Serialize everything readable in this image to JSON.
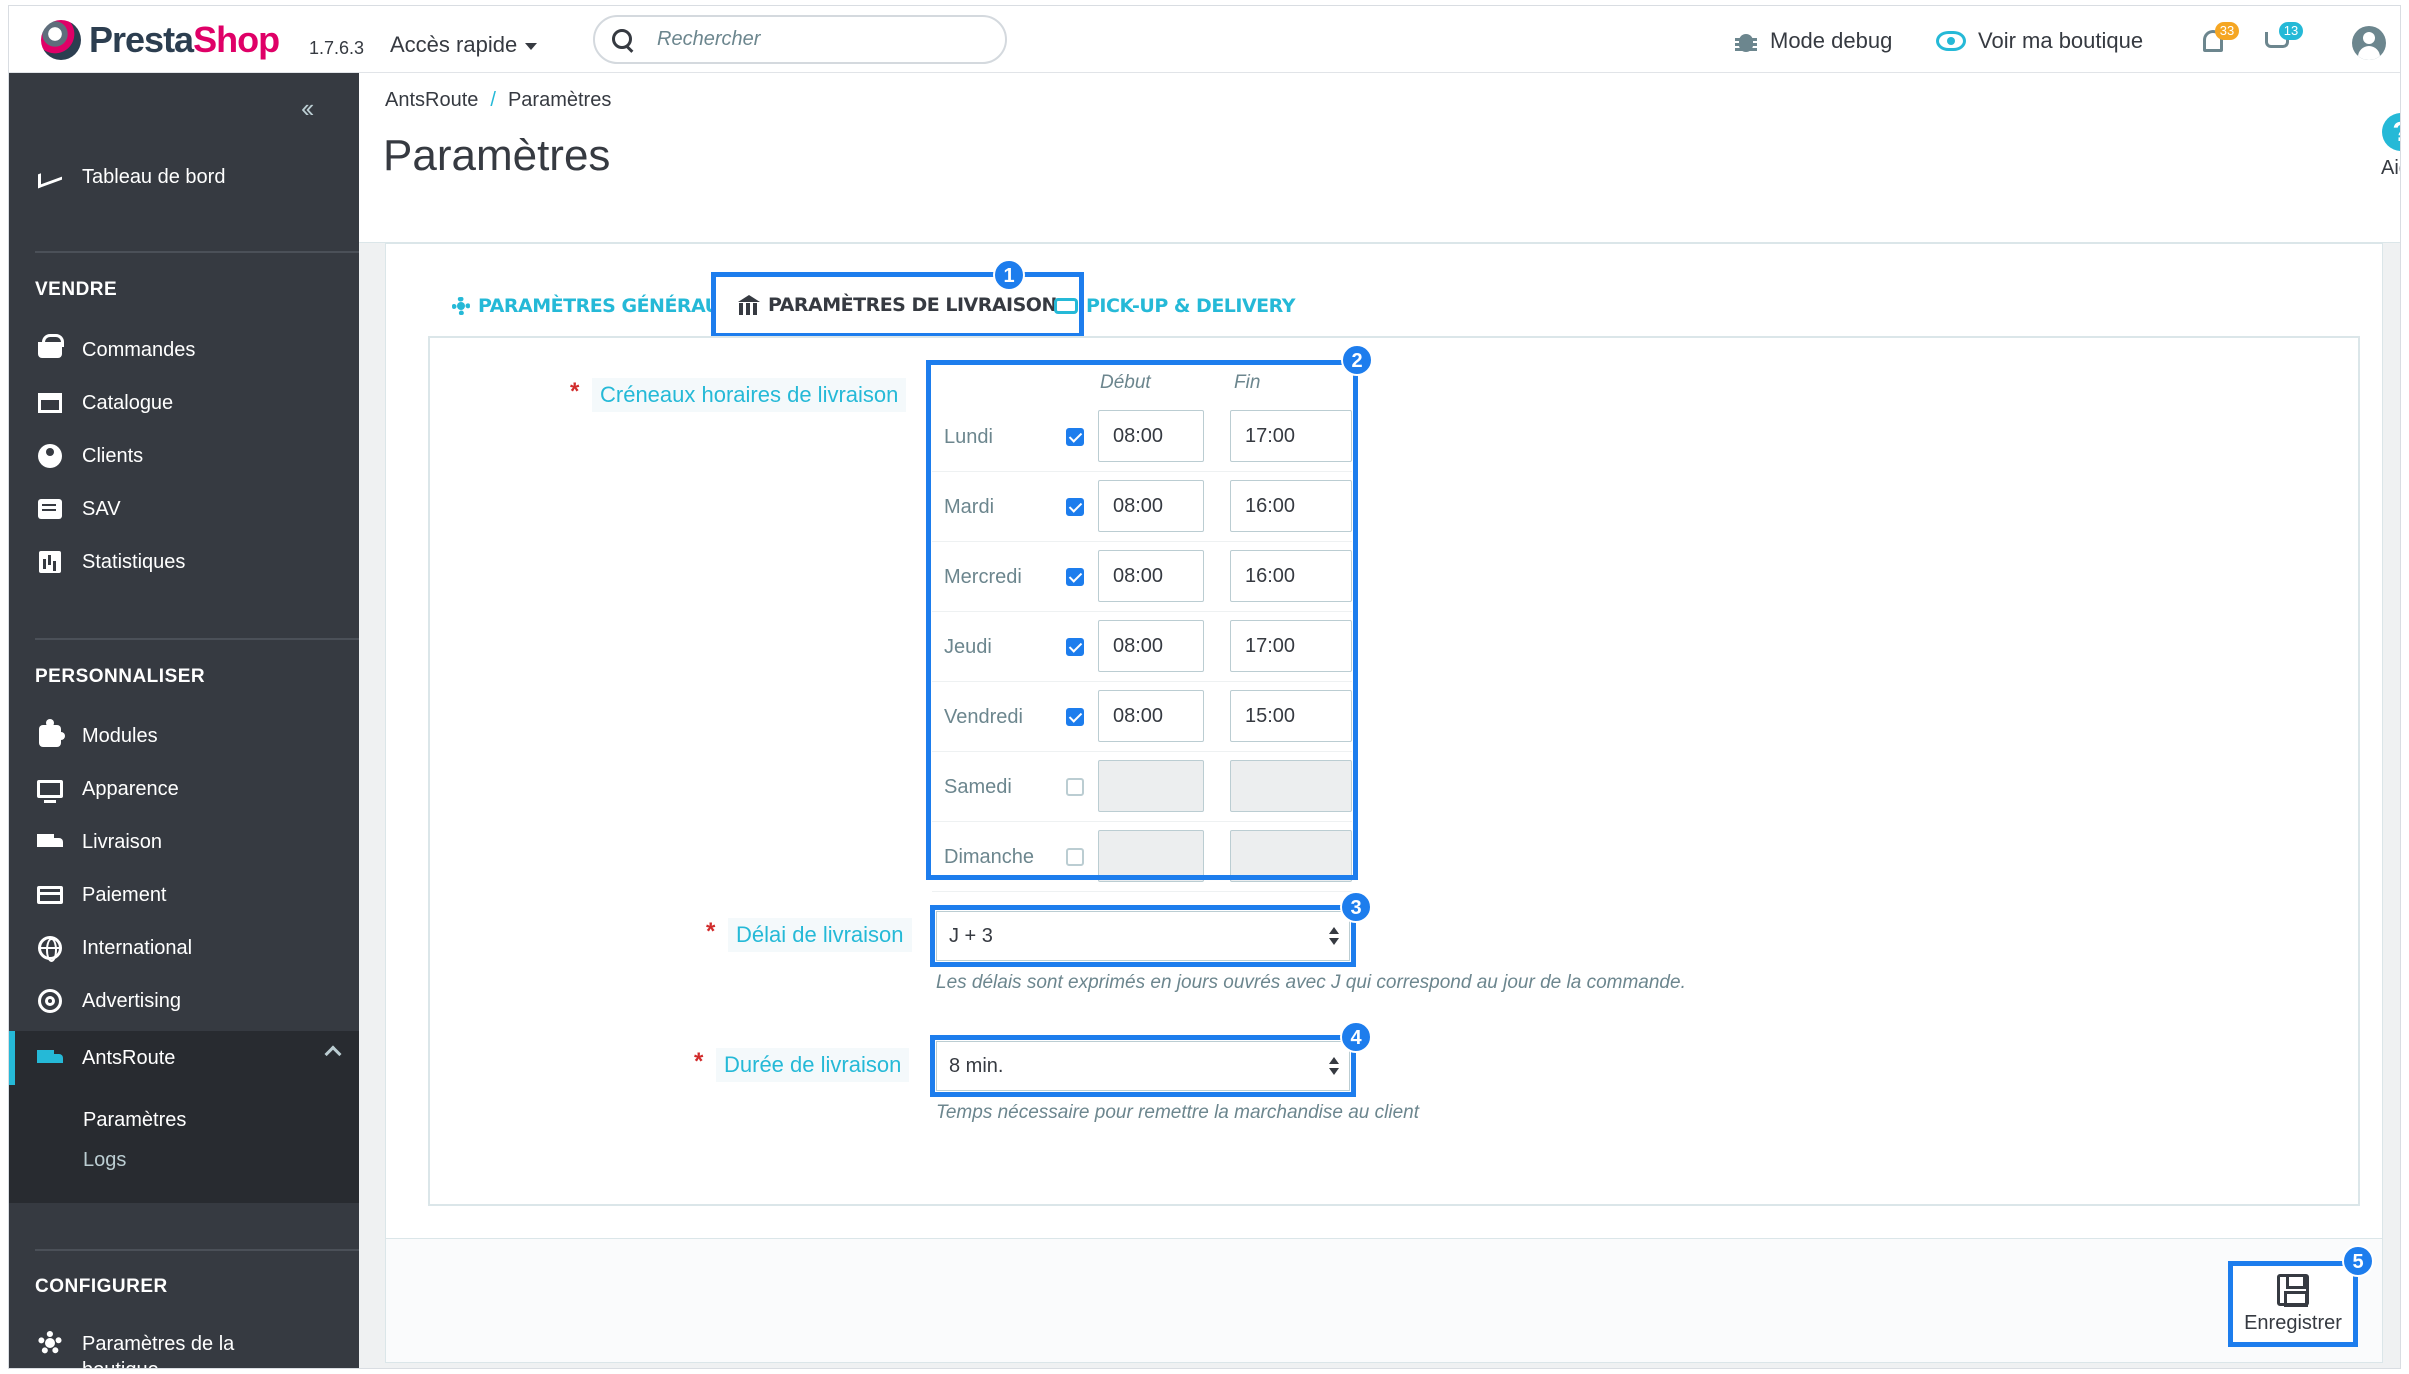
{
  "header": {
    "logo_presta": "Presta",
    "logo_shop": "Shop",
    "version": "1.7.6.3",
    "quick_access": "Accès rapide",
    "search_placeholder": "Rechercher",
    "debug_mode": "Mode debug",
    "view_shop": "Voir ma boutique",
    "notifications_count": "33",
    "orders_count": "13",
    "badge_orange": "#f5a623",
    "badge_blue": "#25b9d7"
  },
  "sidebar": {
    "dashboard": "Tableau de bord",
    "section_sell": "VENDRE",
    "sell_items": [
      "Commandes",
      "Catalogue",
      "Clients",
      "SAV",
      "Statistiques"
    ],
    "section_customize": "PERSONNALISER",
    "customize_items": [
      "Modules",
      "Apparence",
      "Livraison",
      "Paiement",
      "International",
      "Advertising"
    ],
    "active_item": "AntsRoute",
    "submenu": [
      "Paramètres",
      "Logs"
    ],
    "section_configure": "CONFIGURER",
    "configure_items": [
      "Paramètres de la boutique"
    ]
  },
  "page": {
    "breadcrumb_parent": "AntsRoute",
    "breadcrumb_sep": "/",
    "breadcrumb_current": "Paramètres",
    "title": "Paramètres",
    "help_label": "Aide",
    "help_symbol": "?"
  },
  "tabs": {
    "general": "Paramètres généraux",
    "delivery": "Paramètres de livraison",
    "pickup": "Pick-up & Delivery"
  },
  "form": {
    "required_mark": "*",
    "slots_label": "Créneaux horaires de livraison",
    "col_start": "Début",
    "col_end": "Fin",
    "days": [
      {
        "name": "Lundi",
        "checked": true,
        "start": "08:00",
        "end": "17:00"
      },
      {
        "name": "Mardi",
        "checked": true,
        "start": "08:00",
        "end": "16:00"
      },
      {
        "name": "Mercredi",
        "checked": true,
        "start": "08:00",
        "end": "16:00"
      },
      {
        "name": "Jeudi",
        "checked": true,
        "start": "08:00",
        "end": "17:00"
      },
      {
        "name": "Vendredi",
        "checked": true,
        "start": "08:00",
        "end": "15:00"
      },
      {
        "name": "Samedi",
        "checked": false,
        "start": "",
        "end": ""
      },
      {
        "name": "Dimanche",
        "checked": false,
        "start": "",
        "end": ""
      }
    ],
    "delay_label": "Délai de livraison",
    "delay_value": "J + 3",
    "delay_help": "Les délais sont exprimés en jours ouvrés avec J qui correspond au jour de la commande.",
    "duration_label": "Durée de livraison",
    "duration_value": "8 min.",
    "duration_help": "Temps nécessaire pour remettre la marchandise au client",
    "save_label": "Enregistrer"
  },
  "annotations": [
    "1",
    "2",
    "3",
    "4",
    "5"
  ],
  "colors": {
    "accent": "#25b9d7",
    "highlight": "#1d7ded",
    "sidebar_bg": "#363a41",
    "required": "#d12b2b"
  }
}
